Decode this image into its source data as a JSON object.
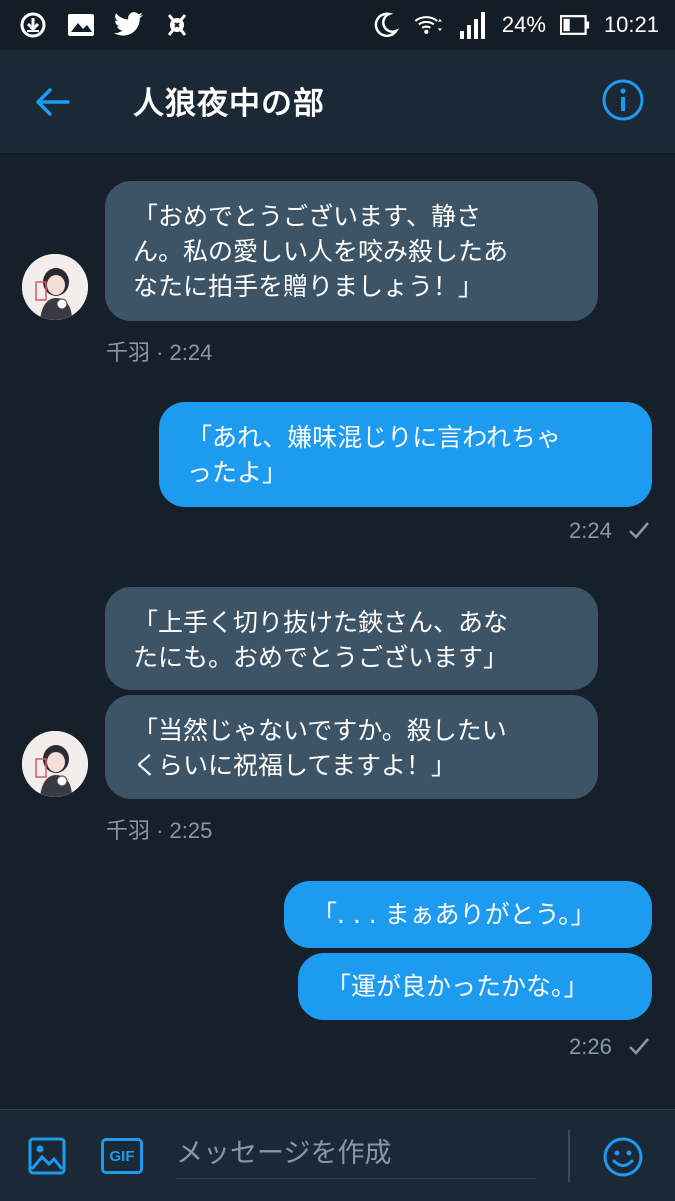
{
  "status_bar": {
    "battery": "24%",
    "time": "10:21",
    "icons": [
      "download-icon",
      "gallery-icon",
      "twitter-icon",
      "bug-icon",
      "moon-icon",
      "wifi-icon",
      "signal-icon",
      "battery-icon"
    ]
  },
  "header": {
    "title": "人狼夜中の部",
    "back_icon": "arrow-left-icon",
    "info_icon": "info-icon"
  },
  "messages": [
    {
      "dir": "in",
      "text": "「おめでとうございます、静さ\nん。私の愛しい人を咬み殺したあ\nなたに拍手を贈りましょう！」",
      "meta": "千羽 · 2:24"
    },
    {
      "dir": "out",
      "text": "「あれ、嫌味混じりに言われちゃ\nったよ」",
      "meta": "2:24"
    },
    {
      "dir": "in",
      "text": "「上手く切り抜けた鋏さん、あな\nたにも。おめでとうございます」"
    },
    {
      "dir": "in",
      "text": "「当然じゃないですか。殺したい\nくらいに祝福してますよ！」",
      "meta": "千羽 · 2:25"
    },
    {
      "dir": "out",
      "text": "「. . . まぁありがとう。」"
    },
    {
      "dir": "out",
      "text": "「運が良かったかな。」",
      "meta": "2:26"
    }
  ],
  "composer": {
    "placeholder": "メッセージを作成",
    "gif_label": "GIF",
    "media_icon": "image-icon",
    "emoji_icon": "emoji-icon"
  },
  "colors": {
    "background": "#15202b",
    "header": "#1b2836",
    "incoming_bubble": "#3d5466",
    "outgoing_bubble": "#1d9bf0",
    "accent": "#1d9bf0",
    "meta_text": "#8899a6"
  }
}
